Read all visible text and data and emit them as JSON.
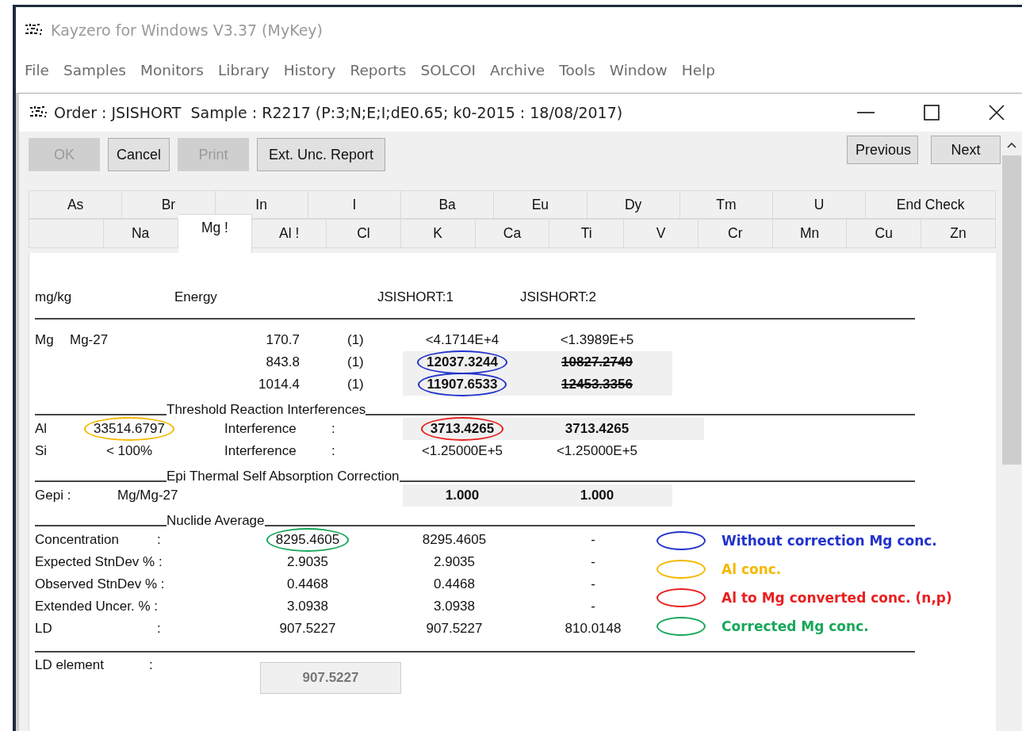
{
  "app_window": {
    "title": "Kayzero for Windows V3.37 (MyKey)",
    "menu": [
      "File",
      "Samples",
      "Monitors",
      "Library",
      "History",
      "Reports",
      "SOLCOI",
      "Archive",
      "Tools",
      "Window",
      "Help"
    ]
  },
  "child_window": {
    "title": "Order : JSISHORT  Sample : R2217 (P:3;N;E;I;dE0.65; k0-2015 : 18/08/2017)"
  },
  "toolbar": {
    "left_buttons": [
      {
        "label": "OK",
        "disabled": true
      },
      {
        "label": "Cancel",
        "disabled": false
      },
      {
        "label": "Print",
        "disabled": true
      },
      {
        "label": "Ext. Unc. Report",
        "disabled": false
      }
    ],
    "right_buttons": [
      {
        "label": "Previous",
        "disabled": false
      },
      {
        "label": "Next",
        "disabled": false
      }
    ]
  },
  "tabs": {
    "upper": [
      {
        "label": "As",
        "selected": false
      },
      {
        "label": "Br",
        "selected": false
      },
      {
        "label": "In",
        "selected": false
      },
      {
        "label": "I",
        "selected": false
      },
      {
        "label": "Ba",
        "selected": false
      },
      {
        "label": "Eu",
        "selected": false
      },
      {
        "label": "Dy",
        "selected": false
      },
      {
        "label": "Tm",
        "selected": false
      },
      {
        "label": "U",
        "selected": false
      },
      {
        "label": "End Check",
        "selected": false
      }
    ],
    "lower": [
      {
        "selected": false
      },
      {
        "label": "Na",
        "selected": false
      },
      {
        "label": "Mg !",
        "selected": true
      },
      {
        "label": "Al !",
        "selected": false
      },
      {
        "label": "Cl",
        "selected": false
      },
      {
        "label": "K",
        "selected": false
      },
      {
        "label": "Ca",
        "selected": false
      },
      {
        "label": "Ti",
        "selected": false
      },
      {
        "label": "V",
        "selected": false
      },
      {
        "label": "Cr",
        "selected": false
      },
      {
        "label": "Mn",
        "selected": false
      },
      {
        "label": "Cu",
        "selected": false
      },
      {
        "label": "Zn",
        "selected": false
      }
    ]
  },
  "results": {
    "header": [
      "mg/kg",
      "Energy",
      "JSISHORT:1",
      "JSISHORT:2"
    ],
    "rows": [
      {
        "kind": "peak",
        "element": "Mg",
        "nuclide": "Mg-27",
        "energy": "170.7",
        "peak": "(1)",
        "shaded": false,
        "values": [
          {
            "text": "<4.1714E+4",
            "bold": false,
            "struck": false
          },
          {
            "text": "<1.3989E+5",
            "bold": false,
            "struck": false
          }
        ]
      },
      {
        "kind": "peak",
        "energy": "843.8",
        "peak": "(1)",
        "shaded": true,
        "values": [
          {
            "text": "12037.3244",
            "bold": true,
            "struck": false,
            "color": "#2233cc"
          },
          {
            "text": "10827.2749",
            "bold": true,
            "struck": true
          }
        ]
      },
      {
        "kind": "peak",
        "energy": "1014.4",
        "peak": "(1)",
        "shaded": true,
        "values": [
          {
            "text": "11907.6533",
            "bold": true,
            "struck": false,
            "color": "#2233cc"
          },
          {
            "text": "12453.3356",
            "bold": true,
            "struck": true
          }
        ]
      },
      {
        "kind": "section",
        "title": "Threshold Reaction Interferences"
      },
      {
        "kind": "interference",
        "element": "Al",
        "amount": {
          "text": "33514.6797",
          "color": "#f5b800"
        },
        "label": "Interference",
        "sep": ":",
        "shaded": true,
        "values": [
          {
            "text": "3713.4265",
            "bold": true,
            "struck": false,
            "color": "#e82020"
          },
          {
            "text": "3713.4265",
            "bold": true,
            "struck": false
          }
        ]
      },
      {
        "kind": "interference",
        "element": "Si",
        "amount": {
          "text": "< 100%"
        },
        "label": "Interference",
        "sep": ":",
        "shaded": false,
        "values": [
          {
            "text": "<1.25000E+5",
            "bold": false,
            "struck": false
          },
          {
            "text": "<1.25000E+5",
            "bold": false,
            "struck": false
          }
        ]
      },
      {
        "kind": "section",
        "title": "Epi Thermal Self Absorption Correction"
      },
      {
        "kind": "gepi",
        "label": "Gepi :",
        "ratio": "Mg/Mg-27",
        "shaded": true,
        "values": [
          {
            "text": "1.000",
            "bold": true,
            "struck": false
          },
          {
            "text": "1.000",
            "bold": true,
            "struck": false
          }
        ]
      },
      {
        "kind": "section",
        "title": "Nuclide Average"
      }
    ],
    "average_rows": [
      {
        "label": "Concentration",
        "sep": ":",
        "values": [
          {
            "text": "8295.4605",
            "bold": false,
            "struck": false,
            "color": "#17a85a"
          },
          {
            "text": "8295.4605",
            "bold": false,
            "struck": false
          },
          {
            "text": "-",
            "bold": false,
            "struck": false
          }
        ]
      },
      {
        "label": "Expected StnDev % :",
        "values": [
          {
            "text": "2.9035",
            "bold": false,
            "struck": false
          },
          {
            "text": "2.9035",
            "bold": false,
            "struck": false
          },
          {
            "text": "-",
            "bold": false,
            "struck": false
          }
        ]
      },
      {
        "label": "Observed StnDev % :",
        "values": [
          {
            "text": "0.4468",
            "bold": false,
            "struck": false
          },
          {
            "text": "0.4468",
            "bold": false,
            "struck": false
          },
          {
            "text": "-",
            "bold": false,
            "struck": false
          }
        ]
      },
      {
        "label": "Extended Uncer. % :",
        "values": [
          {
            "text": "3.0938",
            "bold": false,
            "struck": false
          },
          {
            "text": "3.0938",
            "bold": false,
            "struck": false
          },
          {
            "text": "-",
            "bold": false,
            "struck": false
          }
        ]
      },
      {
        "label": "LD",
        "sep": ":",
        "values": [
          {
            "text": "907.5227",
            "bold": false,
            "struck": false
          },
          {
            "text": "907.5227",
            "bold": false,
            "struck": false
          },
          {
            "text": "810.0148",
            "bold": false,
            "struck": false
          }
        ]
      }
    ],
    "ld_element": {
      "label": "LD element",
      "sep": ":",
      "value": "907.5227"
    }
  },
  "legend": [
    {
      "text": "Without correction Mg conc.",
      "color": "#2233cc"
    },
    {
      "text": "Al conc.",
      "color": "#f5b800"
    },
    {
      "text": "Al to Mg converted conc. (n,p)",
      "color": "#e82020"
    },
    {
      "text": "Corrected Mg conc.",
      "color": "#17a85a"
    }
  ]
}
